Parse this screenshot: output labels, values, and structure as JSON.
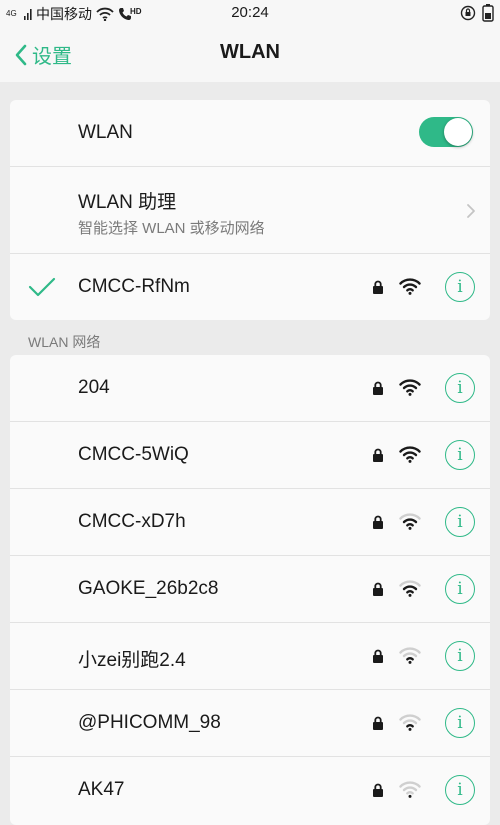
{
  "status_bar": {
    "network_type": "4G",
    "carrier": "中国移动",
    "hd_badge": "HD",
    "time": "20:24",
    "icons": [
      "wifi-icon",
      "call-hd-icon",
      "rotation-lock-icon",
      "battery-icon"
    ]
  },
  "nav": {
    "back_label": "设置",
    "title": "WLAN",
    "back_icon": "chevron-left-icon"
  },
  "settings": {
    "wlan_label": "WLAN",
    "wlan_on": true,
    "assistant_title": "WLAN 助理",
    "assistant_subtitle": "智能选择 WLAN 或移动网络"
  },
  "connected": {
    "ssid": "CMCC-RfNm",
    "secured": true,
    "signal_level": 4
  },
  "section_header": "WLAN 网络",
  "networks": [
    {
      "ssid": "204",
      "secured": true,
      "signal_level": 4
    },
    {
      "ssid": "CMCC-5WiQ",
      "secured": true,
      "signal_level": 4
    },
    {
      "ssid": "CMCC-xD7h",
      "secured": true,
      "signal_level": 3
    },
    {
      "ssid": "GAOKE_26b2c8",
      "secured": true,
      "signal_level": 3
    },
    {
      "ssid": "小zei别跑2.4",
      "secured": true,
      "signal_level": 2
    },
    {
      "ssid": "@PHICOMM_98",
      "secured": true,
      "signal_level": 2
    },
    {
      "ssid": "AK47",
      "secured": true,
      "signal_level": 1
    }
  ],
  "info_glyph": "i",
  "colors": {
    "accent": "#2fb988",
    "background": "#ebebeb",
    "card": "#fafafa",
    "text_primary": "#1a1a1a",
    "text_secondary": "#7a7a7a"
  }
}
